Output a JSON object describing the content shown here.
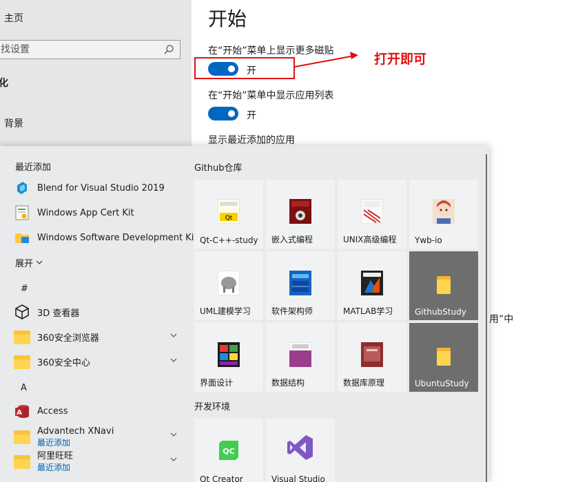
{
  "settings": {
    "sidebar": {
      "home": "主页",
      "search_placeholder": "找设置",
      "section": "化",
      "background": "背景"
    },
    "main": {
      "title": "开始",
      "setting1": "在“开始”菜单上显示更多磁贴",
      "toggle1": "开",
      "setting2": "在“开始”菜单中显示应用列表",
      "toggle2": "开",
      "setting3": "显示最近添加的应用",
      "side_text": "用”中"
    }
  },
  "annotation": {
    "text": "打开即可",
    "color": "#e01010"
  },
  "start_menu": {
    "recent_header": "最近添加",
    "recent": [
      {
        "label": "Blend for Visual Studio 2019",
        "icon": "blend-icon"
      },
      {
        "label": "Windows App Cert Kit",
        "icon": "cert-kit-icon"
      },
      {
        "label": "Windows Software Development Kit",
        "icon": "sdk-folder-icon"
      }
    ],
    "expand": "展开",
    "section_hash": "#",
    "hash_apps": [
      {
        "label": "3D 查看器",
        "icon": "3d-viewer-icon"
      },
      {
        "label": "360安全浏览器",
        "icon": "folder-icon"
      },
      {
        "label": "360安全中心",
        "icon": "folder-icon"
      }
    ],
    "section_a": "A",
    "a_apps": [
      {
        "label": "Access",
        "icon": "access-icon"
      },
      {
        "label": "Advantech XNavi",
        "sub": "最近添加",
        "icon": "folder-icon"
      },
      {
        "label": "阿里旺旺",
        "sub": "最近添加",
        "icon": "folder-icon"
      }
    ],
    "group1": "Github仓库",
    "tiles": [
      {
        "label": "Qt-C++-study",
        "icon": "qt-book-icon"
      },
      {
        "label": "嵌入式编程",
        "icon": "linux-book-icon"
      },
      {
        "label": "UNIX高级编程",
        "icon": "unix-book-icon"
      },
      {
        "label": "Ywb-io",
        "icon": "avatar-icon"
      },
      {
        "label": "UML建模学习",
        "icon": "uml-book-icon"
      },
      {
        "label": "软件架构师",
        "icon": "architect-book-icon"
      },
      {
        "label": "MATLAB学习",
        "icon": "matlab-book-icon"
      },
      {
        "label": "GithubStudy",
        "icon": "folder-icon"
      },
      {
        "label": "界面设计",
        "icon": "ui-book-icon"
      },
      {
        "label": "数据结构",
        "icon": "ds-book-icon"
      },
      {
        "label": "数据库原理",
        "icon": "db-book-icon"
      },
      {
        "label": "UbuntuStudy",
        "icon": "folder-icon"
      }
    ],
    "group2": "开发环境",
    "dev_tiles": [
      {
        "label": "Qt Creator",
        "icon": "qt-creator-icon"
      },
      {
        "label": "Visual Studio",
        "icon": "visual-studio-icon"
      }
    ]
  }
}
